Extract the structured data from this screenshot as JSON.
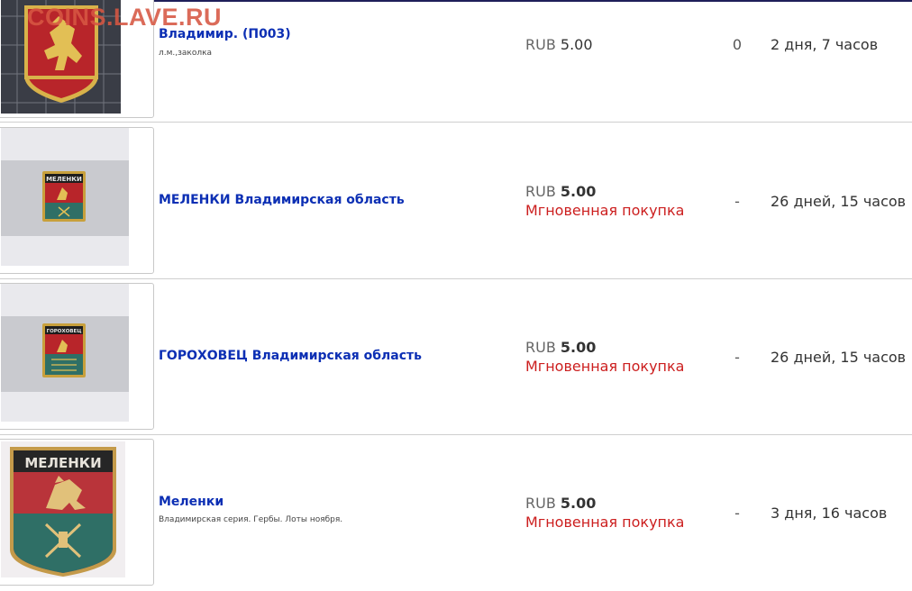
{
  "watermark": "COINS.LAVE.RU",
  "listings": [
    {
      "title": "Владимир. (П003)",
      "subtitle": "л.м.,заколка",
      "currency": "RUB",
      "price": "5.00",
      "buy_now": "",
      "bids": "0",
      "time_left": "2 дня, 7 часов"
    },
    {
      "title": "МЕЛЕНКИ Владимирская область",
      "subtitle": "",
      "currency": "RUB",
      "price": "5.00",
      "buy_now": "Мгновенная покупка",
      "bids": "-",
      "time_left": "26 дней, 15 часов",
      "badge_text": "МЕЛЕНКИ"
    },
    {
      "title": "ГОРОХОВЕЦ Владимирская область",
      "subtitle": "",
      "currency": "RUB",
      "price": "5.00",
      "buy_now": "Мгновенная покупка",
      "bids": "-",
      "time_left": "26 дней, 15 часов",
      "badge_text": "ГОРОХОВЕЦ"
    },
    {
      "title": "Меленки",
      "subtitle": "Владимирская серия. Гербы. Лоты ноября.",
      "currency": "RUB",
      "price": "5.00",
      "buy_now": "Мгновенная покупка",
      "bids": "-",
      "time_left": "3 дня, 16 часов",
      "badge_text": "МЕЛЕНКИ"
    }
  ],
  "colors": {
    "link": "#0c2fb4",
    "buy_now": "#cc1f1f",
    "badge_red": "#b8252a",
    "badge_teal": "#2f6f66",
    "badge_gold": "#d8b24a"
  }
}
